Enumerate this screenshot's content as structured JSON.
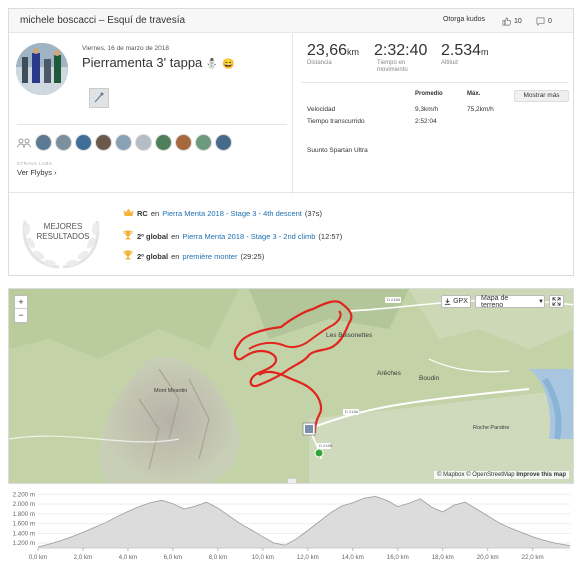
{
  "header": {
    "title": "michele boscacci – Esquí de travesía",
    "kudos_label": "Otorga kudos",
    "kudos_count": "10",
    "comments_count": "0"
  },
  "activity": {
    "date": "Viernes, 16 de marzo de 2018",
    "name": "Pierramenta 3' tappa",
    "emoji_1": "⛄",
    "emoji_2": "😄"
  },
  "stats": {
    "distance_value": "23,66",
    "distance_unit": "km",
    "distance_label": "Distancia",
    "time_value": "2:32:40",
    "time_label_1": "Tiempo en",
    "time_label_2": "movimiento",
    "elev_value": "2.534",
    "elev_unit": "m",
    "elev_label": "Altitud",
    "col_avg": "Promedio",
    "col_max": "Máx.",
    "more_button": "Mostrar más",
    "speed_label": "Velocidad",
    "speed_avg": "9,3km/h",
    "speed_max": "75,2km/h",
    "elapsed_label": "Tiempo transcurrido",
    "elapsed_value": "2:52:04",
    "device": "Suunto Spartan Ultra"
  },
  "labs": {
    "label": "STRAVA LABS",
    "flyby": "Ver Flybys ›"
  },
  "best": {
    "title_1": "MEJORES",
    "title_2": "RESULTADOS",
    "items": [
      {
        "rank": "RC",
        "prep": "en",
        "segment": "Pierra Menta 2018 - Stage 3 - 4th descent",
        "time": "(37s)"
      },
      {
        "rank": "2º global",
        "prep": "en",
        "segment": "Pierra Menta 2018 - Stage 3 - 2nd climb",
        "time": "(12:57)"
      },
      {
        "rank": "2º global",
        "prep": "en",
        "segment": "première monter",
        "time": "(29:25)"
      }
    ]
  },
  "map": {
    "zoom_in": "+",
    "zoom_out": "−",
    "gpx_label": "GPX",
    "map_type": "Mapa de terreno",
    "place_1": "Les Boisonettes",
    "place_2": "Arêches",
    "place_3": "Boudin",
    "place_4": "Roche Parstire",
    "place_5": "Mont Mirantin",
    "road_1": "D 218A",
    "road_2": "D 218A",
    "road_3": "D 218B",
    "attribution_mapbox": "© Mapbox",
    "attribution_osm": "© OpenStreetMap",
    "attribution_improve": "Improve this map"
  },
  "chart_data": {
    "type": "area",
    "x_unit": "km",
    "y_ticks": [
      "2.200 m",
      "2.000 m",
      "1.800 m",
      "1.600 m",
      "1.400 m",
      "1.200 m"
    ],
    "x_ticks": [
      "0,0 km",
      "2,0 km",
      "4,0 km",
      "6,0 km",
      "8,0 km",
      "10,0 km",
      "12,0 km",
      "14,0 km",
      "16,0 km",
      "18,0 km",
      "20,0 km",
      "22,0 km"
    ],
    "ylim": [
      1100,
      2250
    ],
    "xlim": [
      0,
      23.66
    ],
    "x": [
      0,
      0.5,
      1,
      1.5,
      2,
      2.5,
      3,
      3.5,
      4,
      4.5,
      5,
      5.5,
      6,
      6.5,
      7,
      7.5,
      8,
      8.5,
      9,
      9.5,
      10,
      10.5,
      11,
      11.5,
      12,
      12.5,
      13,
      13.5,
      14,
      14.5,
      15,
      15.5,
      16,
      16.5,
      17,
      17.5,
      18,
      18.5,
      19,
      19.5,
      20,
      20.5,
      21,
      21.5,
      22,
      22.5,
      23,
      23.66
    ],
    "y": [
      1120,
      1180,
      1250,
      1330,
      1420,
      1520,
      1620,
      1740,
      1850,
      1950,
      2030,
      2080,
      2010,
      1900,
      1960,
      2040,
      1920,
      1760,
      1600,
      1470,
      1330,
      1200,
      1160,
      1290,
      1460,
      1640,
      1820,
      1960,
      2030,
      2120,
      2160,
      2080,
      1950,
      2020,
      2110,
      1940,
      1840,
      1980,
      2040,
      1900,
      1760,
      1620,
      1510,
      1420,
      1330,
      1260,
      1200,
      1150
    ]
  }
}
